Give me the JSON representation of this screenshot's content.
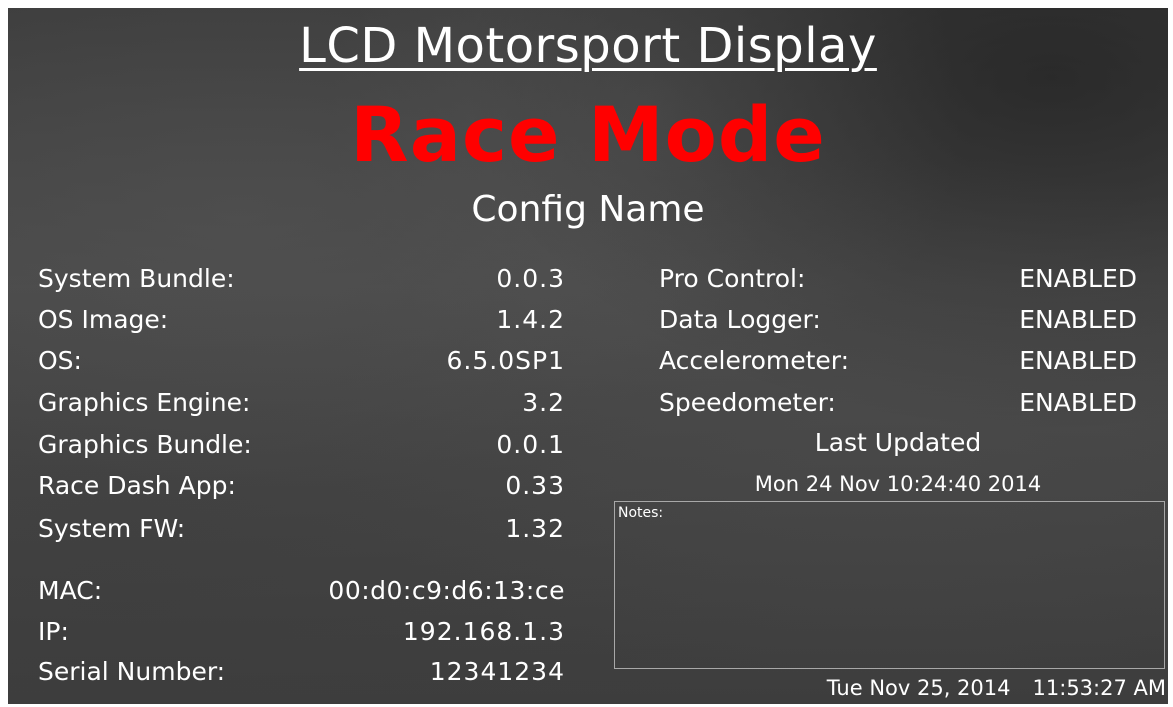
{
  "header": {
    "title": "LCD Motorsport Display",
    "mode": "Race Mode",
    "config_name": "Config Name"
  },
  "system_info": [
    {
      "label": "System Bundle:",
      "value": "0.0.3"
    },
    {
      "label": "OS Image:",
      "value": "1.4.2"
    },
    {
      "label": "OS:",
      "value": "6.5.0SP1"
    },
    {
      "label": "Graphics Engine:",
      "value": "3.2"
    },
    {
      "label": "Graphics Bundle:",
      "value": "0.0.1"
    },
    {
      "label": "Race Dash App:",
      "value": "0.33"
    },
    {
      "label": "System FW:",
      "value": "1.32"
    }
  ],
  "network_info": [
    {
      "label": "MAC:",
      "value": "00:d0:c9:d6:13:ce"
    },
    {
      "label": "IP:",
      "value": "192.168.1.3"
    },
    {
      "label": "Serial Number:",
      "value": "12341234"
    }
  ],
  "features": [
    {
      "label": "Pro Control:",
      "value": "ENABLED"
    },
    {
      "label": "Data Logger:",
      "value": "ENABLED"
    },
    {
      "label": "Accelerometer:",
      "value": "ENABLED"
    },
    {
      "label": "Speedometer:",
      "value": "ENABLED"
    }
  ],
  "last_updated": {
    "label": "Last Updated",
    "date": "Mon 24 Nov 10:24:40 2014"
  },
  "notes": {
    "label": "Notes:",
    "text": ""
  },
  "clock": {
    "date": "Tue Nov 25, 2014",
    "time": "11:53:27 AM"
  },
  "colors": {
    "mode": "#ff0000",
    "text": "#ffffff",
    "background": "#404040",
    "notes_border": "#a8a8a8"
  }
}
